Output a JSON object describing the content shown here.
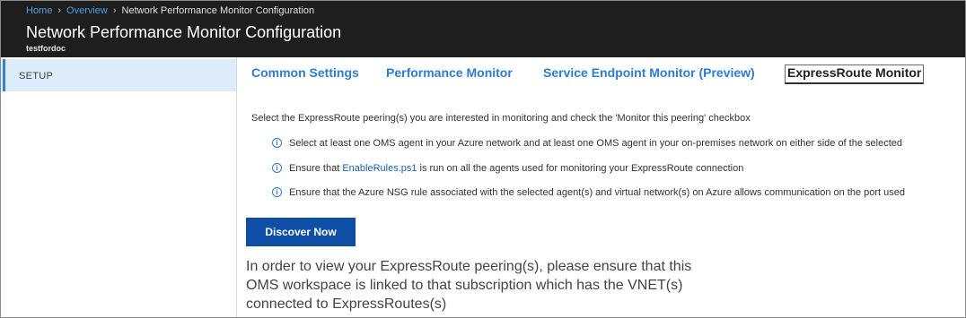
{
  "breadcrumb": {
    "home": "Home",
    "overview": "Overview",
    "current": "Network Performance Monitor Configuration"
  },
  "header": {
    "title": "Network Performance Monitor Configuration",
    "subtitle": "testfordoc"
  },
  "sidebar": {
    "items": [
      {
        "label": "SETUP"
      }
    ]
  },
  "tabs": [
    {
      "label": "Common Settings",
      "active": false
    },
    {
      "label": "Performance Monitor",
      "active": false
    },
    {
      "label": "Service Endpoint Monitor (Preview)",
      "active": false
    },
    {
      "label": "ExpressRoute Monitor",
      "active": true
    }
  ],
  "content": {
    "intro": "Select the ExpressRoute peering(s) you are interested in monitoring and check the 'Monitor this peering' checkbox",
    "notes": [
      {
        "text": "Select at least one OMS agent in your Azure network and at least one OMS agent in your on-premises network on either side of the selected"
      },
      {
        "prefix": "Ensure that ",
        "link": "EnableRules.ps1",
        "suffix": " is run on all the agents used for monitoring your ExpressRoute connection"
      },
      {
        "text": "Ensure that the Azure NSG rule associated with the selected agent(s) and virtual network(s) on Azure allows communication on the port used"
      }
    ],
    "discover_button": "Discover Now",
    "message": "In order to view your ExpressRoute peering(s), please ensure that this OMS workspace is linked to that subscription which has the VNET(s) connected to ExpressRoutes(s)"
  },
  "colors": {
    "header_bg": "#1e1e1e",
    "link": "#2b7cd3",
    "button_bg": "#0f4ea6",
    "sidebar_selected": "#dcecfa"
  },
  "icons": {
    "note_icon": "info-icon"
  }
}
